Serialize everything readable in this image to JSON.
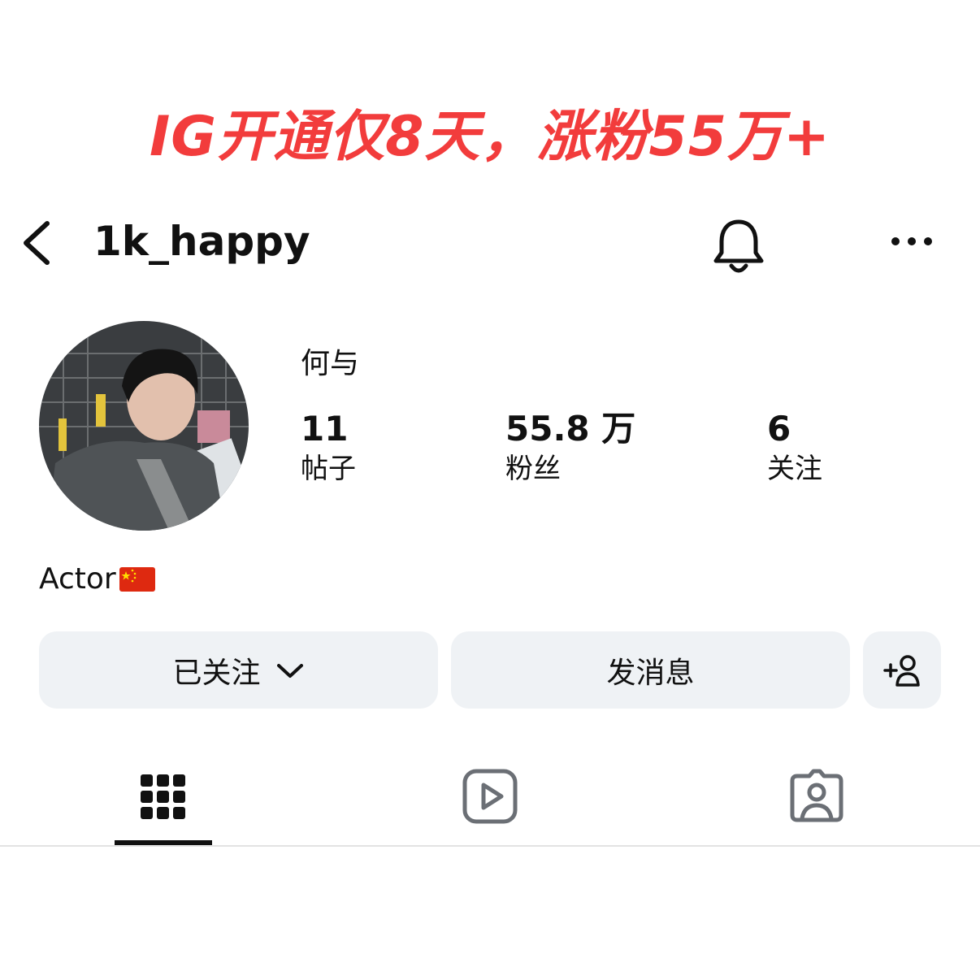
{
  "banner": {
    "headline": "IG开通仅8天，涨粉55万+"
  },
  "header": {
    "username": "1k_happy",
    "icons": {
      "back": "chevron-left-icon",
      "notifications": "bell-icon",
      "more": "ellipsis-icon"
    }
  },
  "profile": {
    "display_name": "何与",
    "stats": [
      {
        "value": "11",
        "label": "帖子"
      },
      {
        "value": "55.8 万",
        "label": "粉丝"
      },
      {
        "value": "6",
        "label": "关注"
      }
    ],
    "bio": "Actor",
    "bio_emoji": "china-flag"
  },
  "actions": {
    "following_label": "已关注",
    "message_label": "发消息",
    "add_user_icon": "add-person-icon"
  },
  "tabs": [
    {
      "name": "posts",
      "icon": "grid-icon",
      "active": true
    },
    {
      "name": "reels",
      "icon": "reels-play-icon",
      "active": false
    },
    {
      "name": "tagged",
      "icon": "tagged-person-icon",
      "active": false
    }
  ],
  "colors": {
    "banner_red": "#f23c3c",
    "button_bg": "#eff2f5",
    "icon_gray": "#6b6f75",
    "text": "#111111"
  }
}
